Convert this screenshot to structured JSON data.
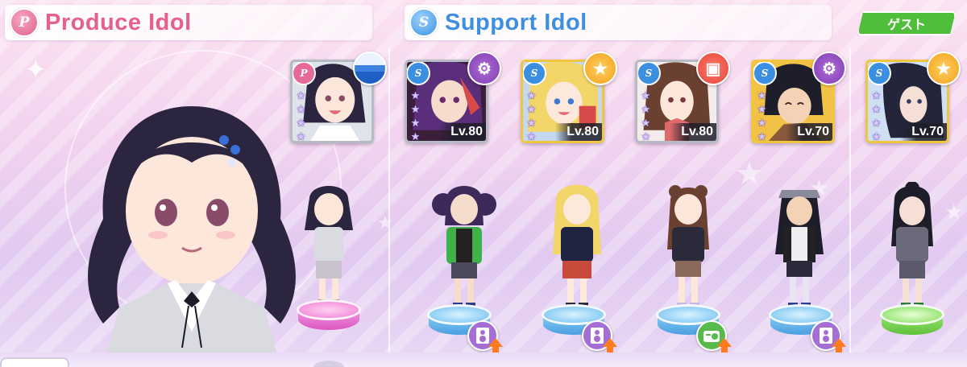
{
  "produce_section": {
    "icon_letter": "P",
    "title": "Produce Idol"
  },
  "support_section": {
    "icon_letter": "S",
    "title": "Support Idol"
  },
  "guest_label": "ゲスト",
  "produce_card": {
    "badge": "P",
    "type_icon": "wave-icon",
    "rarity_stars": 4
  },
  "support_cards": [
    {
      "badge": "S",
      "level": "Lv.80",
      "type_icon": "gear-icon",
      "rarity_stars": 4,
      "frame": "silver",
      "boost_icon": "speaker-icon"
    },
    {
      "badge": "S",
      "level": "Lv.80",
      "type_icon": "star-icon",
      "rarity_stars": 4,
      "frame": "gold",
      "boost_icon": "speaker-icon"
    },
    {
      "badge": "S",
      "level": "Lv.80",
      "type_icon": "school-icon",
      "rarity_stars": 4,
      "frame": "silver",
      "boost_icon": "radio-icon"
    },
    {
      "badge": "S",
      "level": "Lv.70",
      "type_icon": "gear-icon",
      "rarity_stars": 4,
      "frame": "gold",
      "boost_icon": "speaker-icon"
    },
    {
      "badge": "S",
      "level": "Lv.70",
      "type_icon": "star-icon",
      "rarity_stars": 4,
      "frame": "gold",
      "boost_icon": null
    }
  ],
  "colors": {
    "produce_pink": "#e4608f",
    "support_blue": "#3f8fe0",
    "guest_green": "#4fbe3a"
  }
}
